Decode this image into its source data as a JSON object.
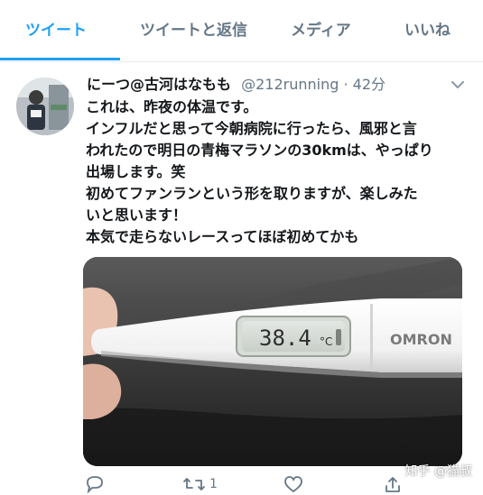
{
  "tabs": [
    {
      "label": "ツイート"
    },
    {
      "label": "ツイートと返信"
    },
    {
      "label": "メディア"
    },
    {
      "label": "いいね"
    }
  ],
  "tweet": {
    "author_name": "にーつ@古河はなもも",
    "handle": "@212running",
    "separator": "·",
    "time": "42分",
    "lines": [
      "これは、昨夜の体温です。",
      "インフルだと思って今朝病院に行ったら、風邪と言",
      "われたので明日の青梅マラソンの30kmは、やっぱり",
      "出場します。笑",
      "初めてファンランという形を取りますが、楽しみた",
      "いと思います！",
      "本気で走らないレースってほぼ初めてかも"
    ],
    "media": {
      "thermometer_reading": "38.4",
      "thermometer_unit": "°C",
      "brand": "OMRON"
    },
    "actions": {
      "retweet_count": "1"
    }
  },
  "watermark": "知乎 @猫叔",
  "colors": {
    "accent": "#1da1f2",
    "secondary_text": "#657786"
  }
}
